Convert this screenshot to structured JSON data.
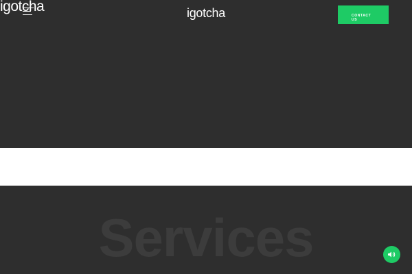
{
  "header": {
    "corner_logo": "igotcha",
    "center_logo": "igotcha",
    "contact_label": "CONTACT US"
  },
  "services": {
    "heading": "Services"
  },
  "icons": {
    "menu": "hamburger-menu-icon",
    "sound": "speaker-icon"
  },
  "colors": {
    "background": "#2e2e2e",
    "accent": "#1ecb65",
    "band": "#ffffff",
    "heading_ghost": "#3c3c3c"
  }
}
